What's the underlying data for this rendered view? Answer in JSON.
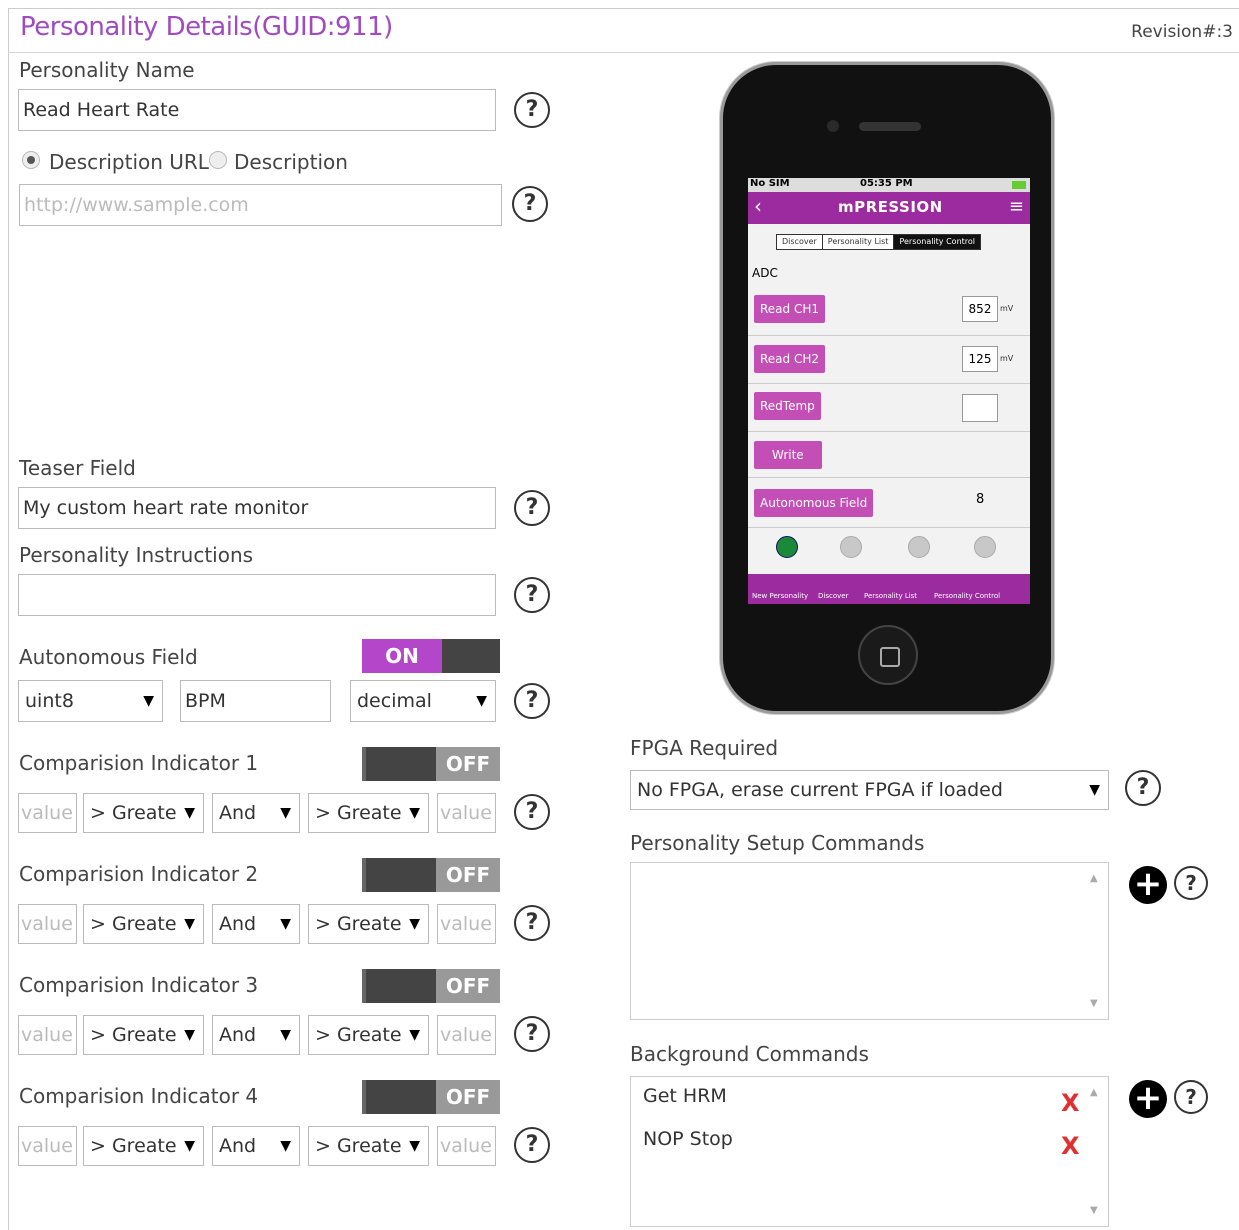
{
  "header": {
    "title": "Personality Details(GUID:911)",
    "revision": "Revision#:3"
  },
  "personality_name": {
    "label": "Personality Name",
    "value": "Read Heart Rate"
  },
  "description": {
    "option_url": "Description URL",
    "option_text": "Description",
    "selected": "Description URL",
    "placeholder": "http://www.sample.com"
  },
  "teaser": {
    "label": "Teaser Field",
    "value": "My custom heart rate monitor"
  },
  "instructions": {
    "label": "Personality Instructions",
    "value": ""
  },
  "autonomous": {
    "label": "Autonomous Field",
    "toggle": "ON",
    "type": "uint8",
    "unit": "BPM",
    "format": "decimal"
  },
  "comparisons": [
    {
      "label": "Comparision Indicator 1",
      "toggle": "OFF",
      "value1": "value",
      "op1": "> Greate",
      "logic": "And",
      "op2": "> Greate",
      "value2": "value"
    },
    {
      "label": "Comparision Indicator 2",
      "toggle": "OFF",
      "value1": "value",
      "op1": "> Greate",
      "logic": "And",
      "op2": "> Greate",
      "value2": "value"
    },
    {
      "label": "Comparision Indicator 3",
      "toggle": "OFF",
      "value1": "value",
      "op1": "> Greate",
      "logic": "And",
      "op2": "> Greate",
      "value2": "value"
    },
    {
      "label": "Comparision Indicator 4",
      "toggle": "OFF",
      "value1": "value",
      "op1": "> Greate",
      "logic": "And",
      "op2": "> Greate",
      "value2": "value"
    }
  ],
  "help_glyph": "?",
  "plus_glyph": "+",
  "remove_glyph": "X",
  "select_arrow": "▼",
  "fpga": {
    "label": "FPGA Required",
    "value": "No FPGA, erase current FPGA if loaded"
  },
  "setup_commands": {
    "label": "Personality Setup Commands",
    "items": []
  },
  "background_commands": {
    "label": "Background Commands",
    "items": [
      "Get HRM",
      "NOP Stop"
    ]
  },
  "phone_preview": {
    "carrier": "No SIM",
    "time": "05:35 PM",
    "brand": "mPRESSION",
    "back_glyph": "‹",
    "menu_glyph": "≡",
    "segments": [
      "Discover",
      "Personality List",
      "Personality Control"
    ],
    "active_segment": "Personality Control",
    "section": "ADC",
    "rows": [
      {
        "button": "Read CH1",
        "value": "852",
        "unit": "mV"
      },
      {
        "button": "Read CH2",
        "value": "125",
        "unit": "mV"
      },
      {
        "button": "RedTemp",
        "value": "",
        "unit": ""
      },
      {
        "button": "Write",
        "value": "",
        "unit": ""
      },
      {
        "button": "Autonomous Field",
        "value": "8",
        "unit": ""
      }
    ],
    "indicators": [
      "green",
      "gray",
      "gray",
      "gray"
    ],
    "tabs": [
      "New Personality",
      "Discover",
      "Personality List",
      "Personality Control"
    ],
    "colors": {
      "accent": "#9b2b9f",
      "button": "#c34fb6",
      "on_toggle": "#b447c9",
      "remove": "#e03030"
    }
  }
}
